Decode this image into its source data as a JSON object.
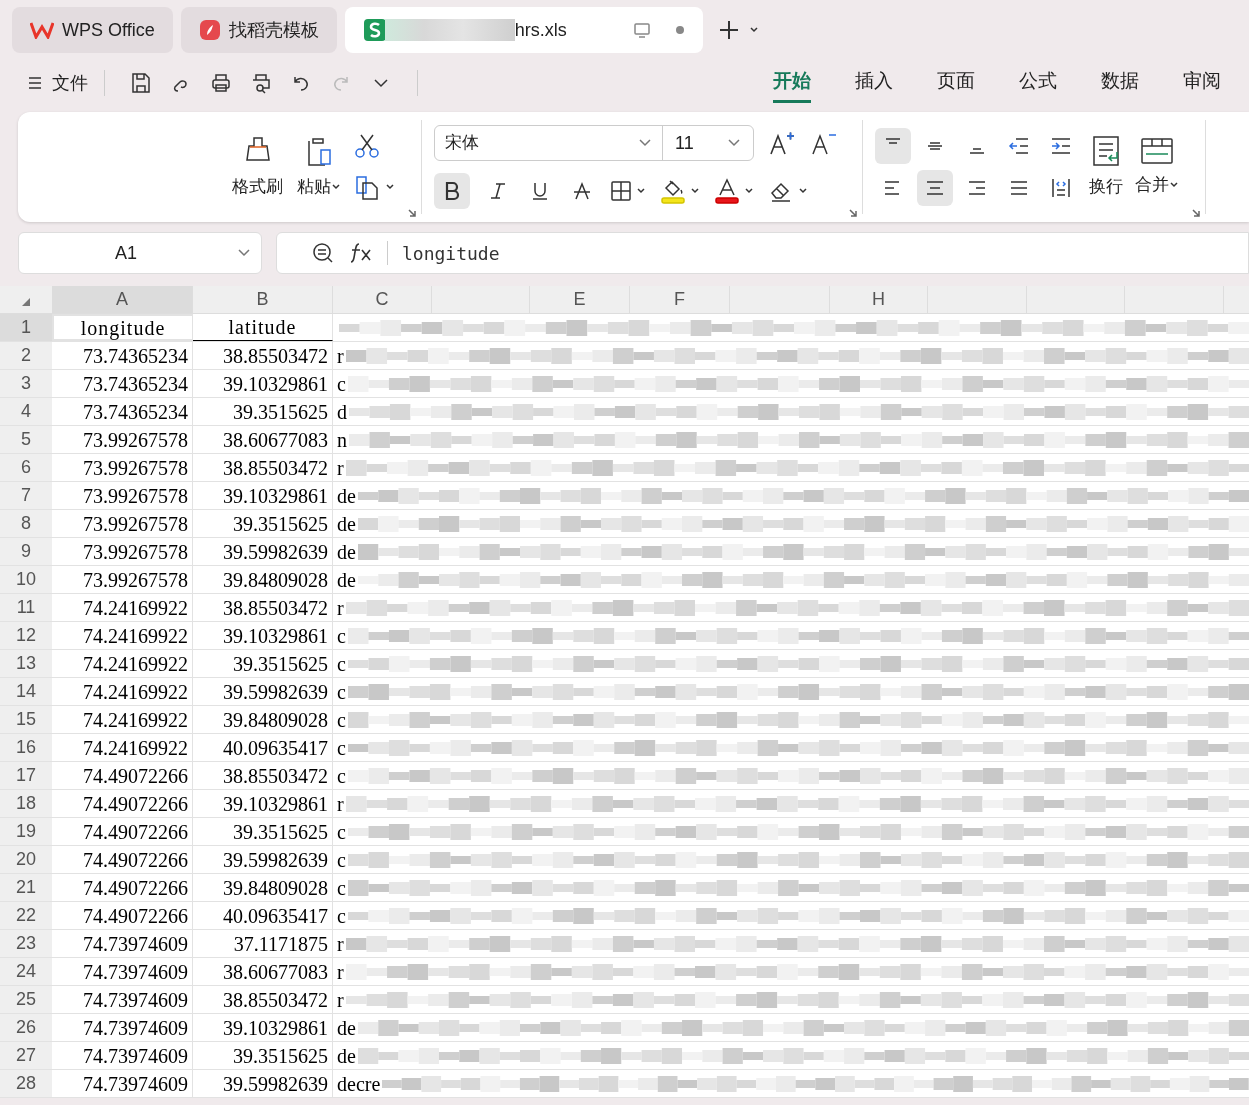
{
  "app_tabs": [
    {
      "kind": "wps",
      "label": "WPS Office",
      "selected": false
    },
    {
      "kind": "docer",
      "label": "找稻壳模板",
      "selected": false
    },
    {
      "kind": "sheet",
      "label": "hrs.xls",
      "selected": true
    }
  ],
  "file_menu": "文件",
  "ribbon_tabs": [
    {
      "label": "开始",
      "selected": true
    },
    {
      "label": "插入",
      "selected": false
    },
    {
      "label": "页面",
      "selected": false
    },
    {
      "label": "公式",
      "selected": false
    },
    {
      "label": "数据",
      "selected": false
    },
    {
      "label": "审阅",
      "selected": false
    }
  ],
  "ribbon": {
    "format_painter": "格式刷",
    "paste": "粘贴",
    "font": "宋体",
    "font_size": "11",
    "bold": true,
    "align_top": true,
    "align_center": true,
    "wrap": "换行",
    "merge": "合并"
  },
  "name_box": "A1",
  "formula": "longitude",
  "columns": [
    {
      "label": "A",
      "selected": true
    },
    {
      "label": "B",
      "selected": false
    },
    {
      "label": "C",
      "selected": false
    },
    {
      "label": "E",
      "selected": false
    },
    {
      "label": "F",
      "selected": false
    },
    {
      "label": "H",
      "selected": false
    }
  ],
  "rows": [
    {
      "n": "1",
      "a": "longitude",
      "b": "latitude",
      "kind": "header"
    },
    {
      "n": "2",
      "a": "73.74365234",
      "b": "38.85503472",
      "c": "r"
    },
    {
      "n": "3",
      "a": "73.74365234",
      "b": "39.10329861",
      "c": "c"
    },
    {
      "n": "4",
      "a": "73.74365234",
      "b": "39.3515625",
      "c": "d"
    },
    {
      "n": "5",
      "a": "73.99267578",
      "b": "38.60677083",
      "c": "n"
    },
    {
      "n": "6",
      "a": "73.99267578",
      "b": "38.85503472",
      "c": "r"
    },
    {
      "n": "7",
      "a": "73.99267578",
      "b": "39.10329861",
      "c": "de"
    },
    {
      "n": "8",
      "a": "73.99267578",
      "b": "39.3515625",
      "c": "de"
    },
    {
      "n": "9",
      "a": "73.99267578",
      "b": "39.59982639",
      "c": "de"
    },
    {
      "n": "10",
      "a": "73.99267578",
      "b": "39.84809028",
      "c": "de"
    },
    {
      "n": "11",
      "a": "74.24169922",
      "b": "38.85503472",
      "c": "r"
    },
    {
      "n": "12",
      "a": "74.24169922",
      "b": "39.10329861",
      "c": "c"
    },
    {
      "n": "13",
      "a": "74.24169922",
      "b": "39.3515625",
      "c": "c"
    },
    {
      "n": "14",
      "a": "74.24169922",
      "b": "39.59982639",
      "c": "c"
    },
    {
      "n": "15",
      "a": "74.24169922",
      "b": "39.84809028",
      "c": "c"
    },
    {
      "n": "16",
      "a": "74.24169922",
      "b": "40.09635417",
      "c": "c"
    },
    {
      "n": "17",
      "a": "74.49072266",
      "b": "38.85503472",
      "c": "c"
    },
    {
      "n": "18",
      "a": "74.49072266",
      "b": "39.10329861",
      "c": "r"
    },
    {
      "n": "19",
      "a": "74.49072266",
      "b": "39.3515625",
      "c": "c"
    },
    {
      "n": "20",
      "a": "74.49072266",
      "b": "39.59982639",
      "c": "c"
    },
    {
      "n": "21",
      "a": "74.49072266",
      "b": "39.84809028",
      "c": "c"
    },
    {
      "n": "22",
      "a": "74.49072266",
      "b": "40.09635417",
      "c": "c"
    },
    {
      "n": "23",
      "a": "74.73974609",
      "b": "37.1171875",
      "c": "r"
    },
    {
      "n": "24",
      "a": "74.73974609",
      "b": "38.60677083",
      "c": "r"
    },
    {
      "n": "25",
      "a": "74.73974609",
      "b": "38.85503472",
      "c": "r"
    },
    {
      "n": "26",
      "a": "74.73974609",
      "b": "39.10329861",
      "c": "de"
    },
    {
      "n": "27",
      "a": "74.73974609",
      "b": "39.3515625",
      "c": "de"
    },
    {
      "n": "28",
      "a": "74.73974609",
      "b": "39.59982639",
      "c": "decre"
    }
  ]
}
